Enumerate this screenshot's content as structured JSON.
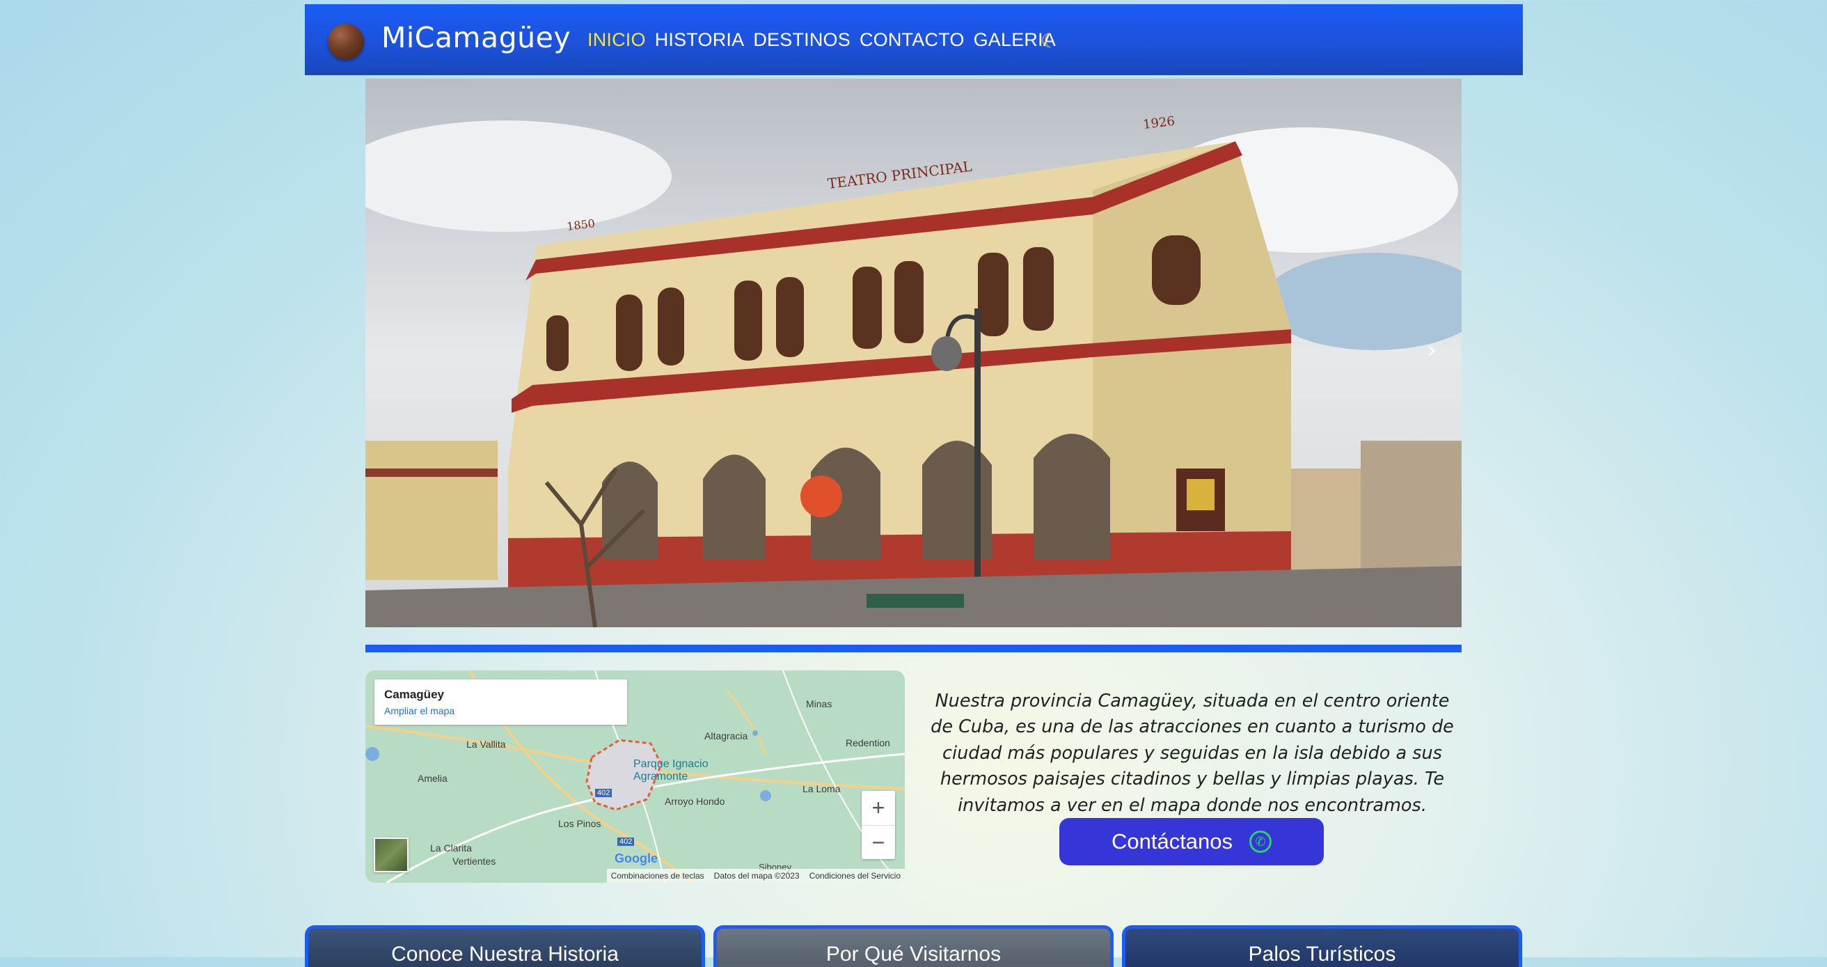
{
  "header": {
    "brand": "MiCamagüey",
    "nav": [
      "INICIO",
      "HISTORIA",
      "DESTINOS",
      "CONTACTO",
      "GALERIA"
    ],
    "active_index": 0,
    "theme_toggle_icon": "moon-icon"
  },
  "hero": {
    "sign_center": "TEATRO PRINCIPAL",
    "year_left": "1850",
    "year_right": "1926",
    "next_icon": "chevron-right-icon"
  },
  "map": {
    "title": "Camagüey",
    "enlarge_link": "Ampliar el mapa",
    "places": [
      "Minas",
      "La Vallita",
      "Altagracia",
      "Redention",
      "Amelia",
      "Parque Ignacio Agramonte",
      "Arroyo Hondo",
      "La Loma",
      "Los Pinos",
      "La Clarita",
      "Vertientes",
      "402",
      "402",
      "Siboney"
    ],
    "zoom_in": "+",
    "zoom_out": "−",
    "attribution": [
      "Combinaciones de teclas",
      "Datos del mapa ©2023",
      "Condiciones del Servicio"
    ],
    "logo": "Google"
  },
  "intro": {
    "text": "Nuestra provincia Camagüey, situada en el centro oriente de Cuba, es una de las atracciones en cuanto a turismo de ciudad más populares y seguidas en la isla debido a sus hermosos paisajes citadinos y bellas y limpias playas. Te invitamos a ver en el mapa donde nos encontramos.",
    "cta_label": "Contáctanos",
    "cta_icon": "whatsapp-icon"
  },
  "cards": [
    "Conoce Nuestra Historia",
    "Por Qué Visitarnos",
    "Palos Turísticos"
  ],
  "colors": {
    "nav_blue": "#1a5cf5",
    "active_nav": "#f5e43a",
    "cta": "#3636d8"
  }
}
